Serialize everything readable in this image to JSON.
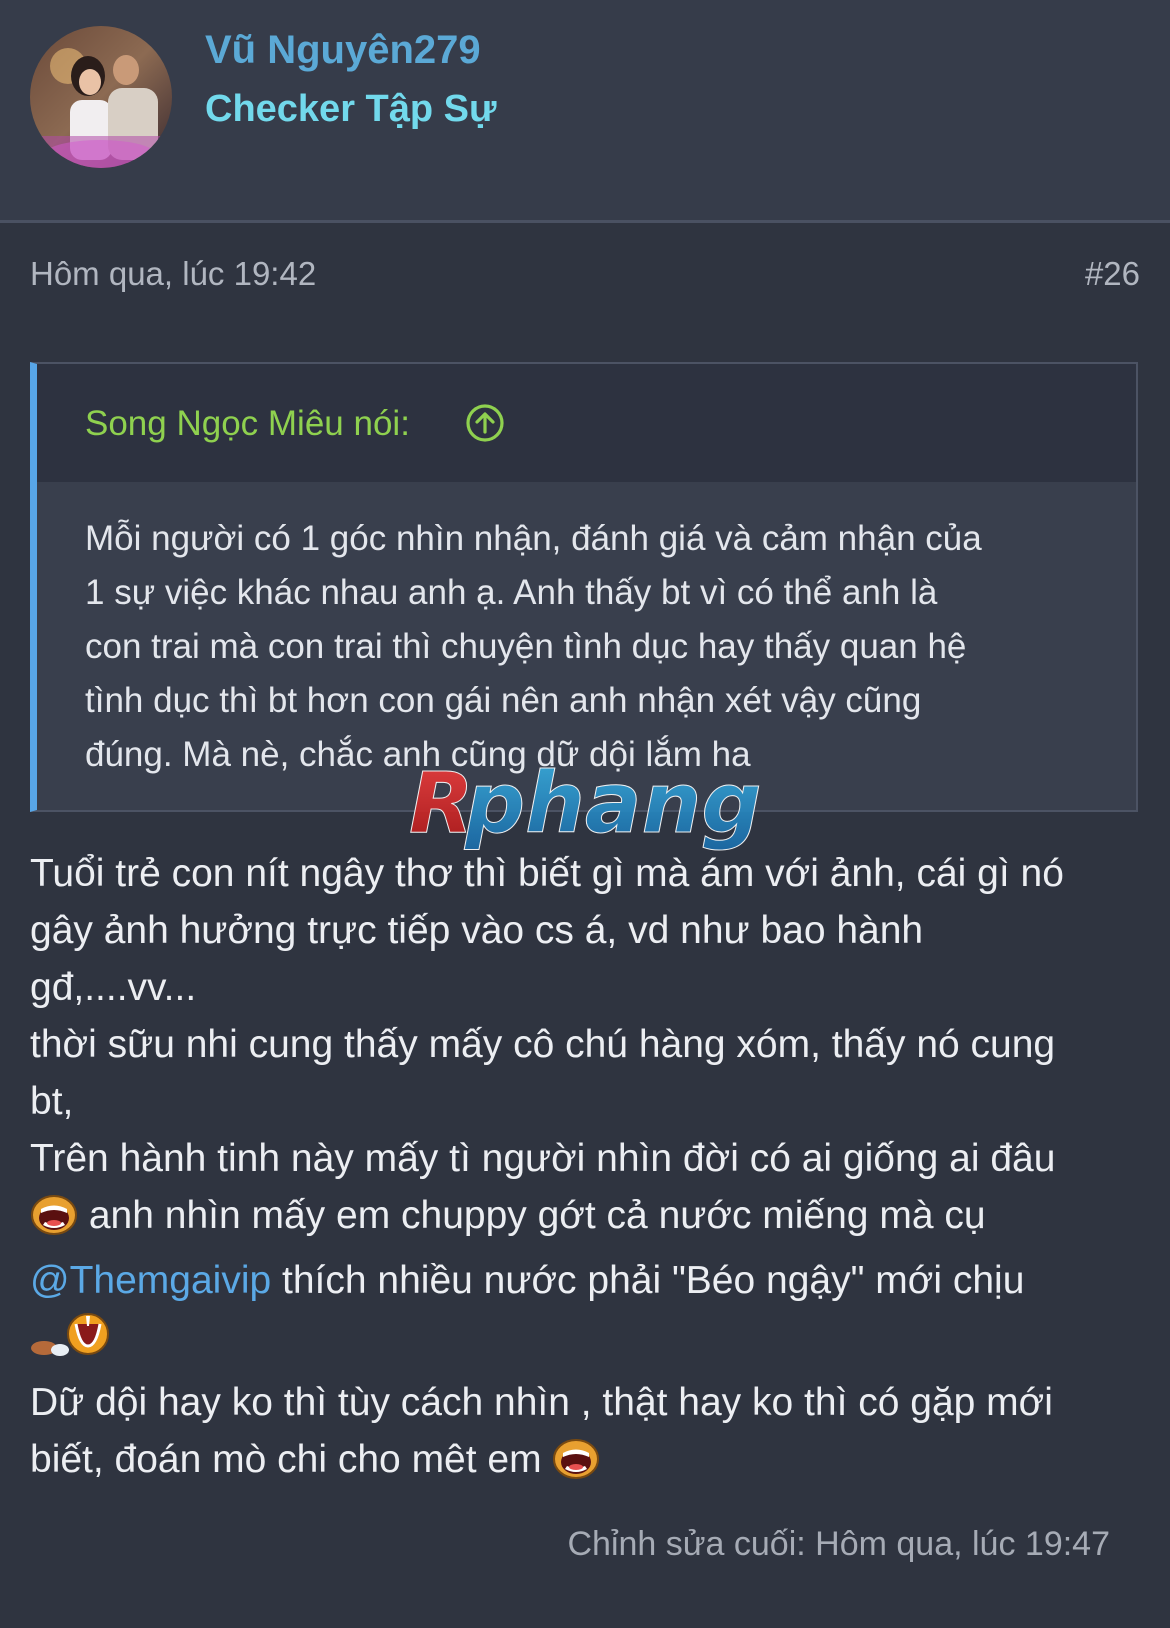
{
  "user": {
    "name": "Vũ Nguyên279",
    "title": "Checker Tập Sự"
  },
  "post": {
    "date": "Hôm qua, lúc 19:42",
    "number": "#26",
    "edited": "Chỉnh sửa cuối: Hôm qua, lúc 19:47"
  },
  "quote": {
    "author": "Song Ngọc Miêu nói:",
    "lines": [
      "Mỗi người có 1 góc nhìn nhận, đánh giá và cảm nhận của",
      "1 sự việc khác nhau anh ạ. Anh thấy bt vì có thể anh là",
      "con trai mà con trai thì chuyện tình dục hay thấy quan hệ",
      "tình dục thì bt hơn con gái nên anh nhận xét vậy cũng",
      "đúng. Mà nè, chắc anh cũng dữ dội lắm ha"
    ]
  },
  "watermark": {
    "text": "Rphang"
  },
  "body": {
    "line1": "Tuổi trẻ con nít ngây thơ thì biết gì mà ám với ảnh, cái gì nó",
    "line2": "gây ảnh hưởng trực tiếp vào cs á, vd như bao hành",
    "line3": "gđ,....vv...",
    "line4": "thời sữu nhi cung thấy mấy cô chú hàng xóm, thấy nó cung",
    "line5": "bt,",
    "line6": "Trên hành tinh này mấy tì người nhìn đời có ai giống ai đâu",
    "line7": "anh nhìn mấy em chuppy gớt cả nước miếng mà cụ",
    "mention": "@Themgaivip",
    "line8_rest": "thích nhiều nước phải \"Béo ngậy\" mới chịu",
    "line10": "Dữ dội hay ko thì tùy cách nhìn , thật hay ko thì có gặp mới",
    "line11": "biết, đoán mò chi cho mêt em"
  },
  "icons": {
    "avatar": "profile-photo",
    "quote_up": "arrow-up-circle-icon",
    "smilie_laugh": "laughing-face-icon",
    "smilie_drool": "drooling-face-icon"
  },
  "colors": {
    "background": "#2f3440",
    "username": "#5ba9d6",
    "user_title": "#72d9ec",
    "quote_author": "#8fd14f",
    "quote_border": "#58a6e8",
    "mention": "#5ba9e6"
  }
}
